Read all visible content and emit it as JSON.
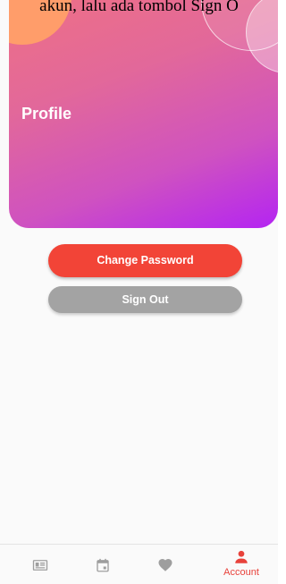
{
  "caption": "akun, lalu ada tombol Sign O",
  "header": {
    "title": "Profile"
  },
  "actions": {
    "change_password": "Change Password",
    "sign_out": "Sign Out"
  },
  "bottom_nav": {
    "items": [
      {
        "icon": "newspaper-icon",
        "label": ""
      },
      {
        "icon": "calendar-icon",
        "label": ""
      },
      {
        "icon": "heart-icon",
        "label": ""
      },
      {
        "icon": "person-icon",
        "label": "Account"
      }
    ],
    "active_index": 3,
    "active_color": "#e8423b",
    "inactive_color": "#9e9e9e"
  },
  "colors": {
    "primary_button": "#f24437",
    "secondary_button": "#a3a3a3"
  }
}
